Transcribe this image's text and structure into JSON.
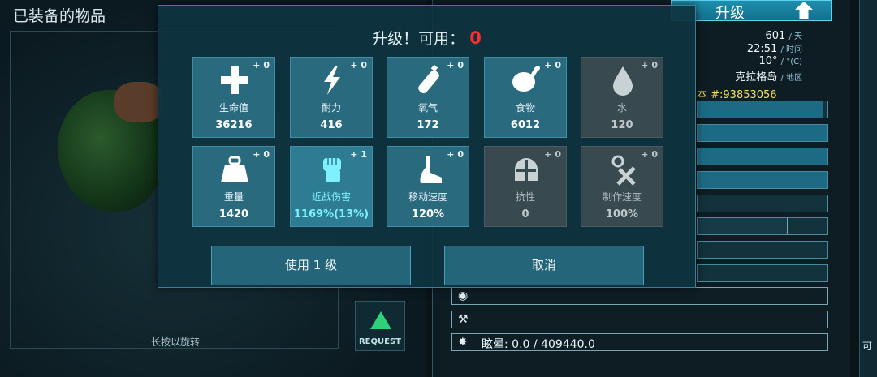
{
  "left_panel": {
    "title": "已装备的物品",
    "rotate_hint": "长按以旋转",
    "request_label": "REQUEST"
  },
  "top_bar": {
    "upgrade_label": "升级"
  },
  "world_info": {
    "day_value": "601",
    "day_unit": "/ 天",
    "time_value": "22:51",
    "time_unit": "/ 时间",
    "temp_value": "10°",
    "temp_unit": "/ °(C)",
    "place_value": "克拉格岛",
    "place_unit": "/ 地区"
  },
  "creature": {
    "tame_id": "本 #:93853056",
    "stun_icon": "stun-icon",
    "stun_text": "眩晕: 0.0 / 409440.0"
  },
  "dialog": {
    "header_label": "升级！可用：",
    "points_available": "0",
    "stats_row1": [
      {
        "icon": "health-cross-icon",
        "plus": "+ 0",
        "label": "生命值",
        "value": "36216",
        "state": "normal"
      },
      {
        "icon": "stamina-bolt-icon",
        "plus": "+ 0",
        "label": "耐力",
        "value": "416",
        "state": "normal"
      },
      {
        "icon": "oxygen-tank-icon",
        "plus": "+ 0",
        "label": "氧气",
        "value": "172",
        "state": "normal"
      },
      {
        "icon": "food-meat-icon",
        "plus": "+ 0",
        "label": "食物",
        "value": "6012",
        "state": "normal"
      },
      {
        "icon": "water-drop-icon",
        "plus": "+ 0",
        "label": "水",
        "value": "120",
        "state": "disabled"
      }
    ],
    "stats_row2": [
      {
        "icon": "weight-icon",
        "plus": "+ 0",
        "label": "重量",
        "value": "1420",
        "state": "normal"
      },
      {
        "icon": "melee-fist-icon",
        "plus": "+ 1",
        "label": "近战伤害",
        "value": "1169%(13%)",
        "state": "active"
      },
      {
        "icon": "speed-foot-icon",
        "plus": "+ 0",
        "label": "移动速度",
        "value": "120%",
        "state": "normal"
      },
      {
        "icon": "fortitude-helmet-icon",
        "plus": "+ 0",
        "label": "抗性",
        "value": "0",
        "state": "disabled"
      },
      {
        "icon": "crafting-tools-icon",
        "plus": "+ 0",
        "label": "制作速度",
        "value": "100%",
        "state": "disabled"
      }
    ],
    "use_button_label": "使用 1 级",
    "cancel_button_label": "取消"
  },
  "colors": {
    "dialog_bg": "#0e3440",
    "cell_normal": "#2a6a7e",
    "cell_disabled": "#384a50",
    "cell_active_text": "#7ff0ff",
    "points_red": "#ff2e2e",
    "tame_id_yellow": "#f4e05c"
  },
  "edge_label": "可"
}
